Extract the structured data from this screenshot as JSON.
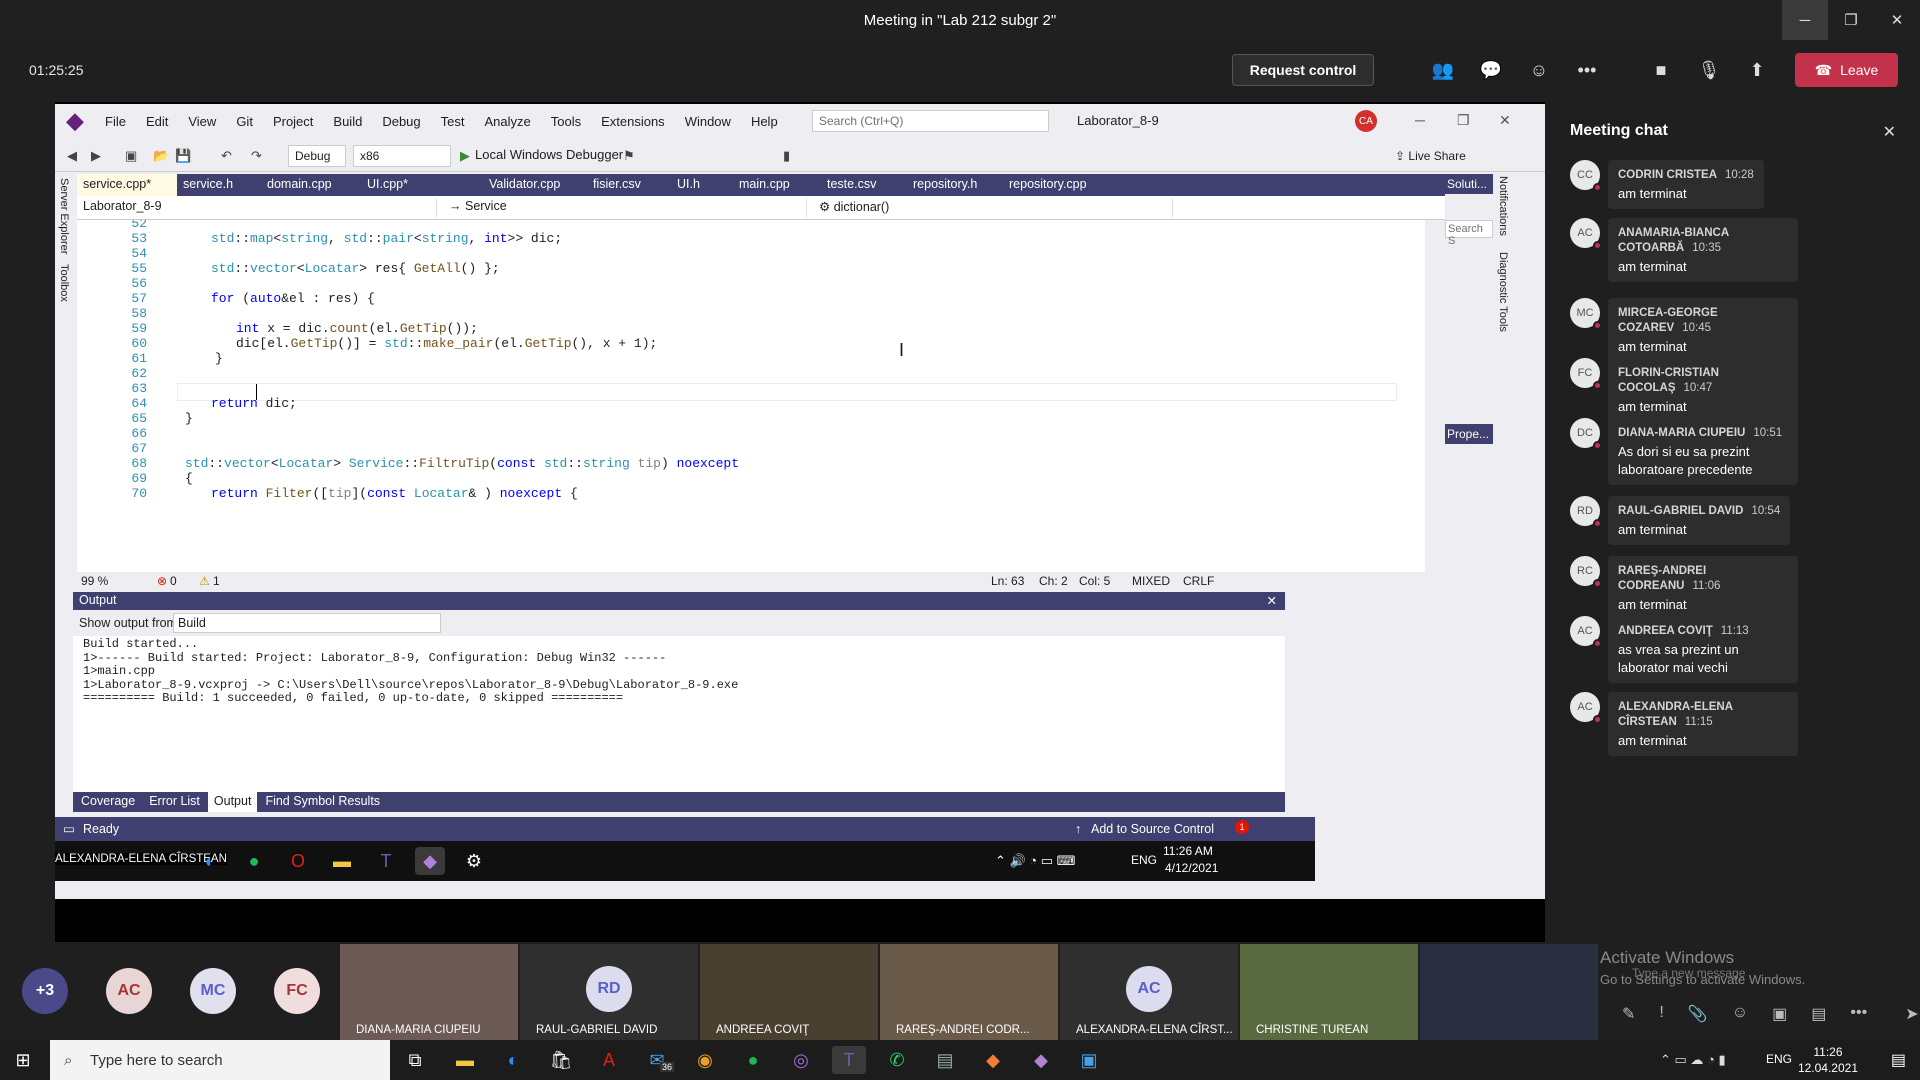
{
  "teams": {
    "title": "Meeting in \"Lab 212 subgr 2\"",
    "timer": "01:25:25",
    "request_control": "Request control",
    "leave": "Leave"
  },
  "vs": {
    "menu": [
      "File",
      "Edit",
      "View",
      "Git",
      "Project",
      "Build",
      "Debug",
      "Test",
      "Analyze",
      "Tools",
      "Extensions",
      "Window",
      "Help"
    ],
    "search_placeholder": "Search (Ctrl+Q)",
    "solution_name": "Laborator_8-9",
    "avatar": "CA",
    "config": "Debug",
    "platform": "x86",
    "run": "Local Windows Debugger",
    "live_share": "Live Share",
    "left_tabs": [
      "Server Explorer",
      "Toolbox"
    ],
    "tabs": [
      "service.cpp*",
      "service.h",
      "domain.cpp",
      "UI.cpp*",
      "Validator.cpp",
      "fisier.csv",
      "UI.h",
      "main.cpp",
      "teste.csv",
      "repository.h",
      "repository.cpp"
    ],
    "nav_project": "Laborator_8-9",
    "nav_class": "Service",
    "nav_member": "dictionar()",
    "line_numbers": [
      "52",
      "53",
      "54",
      "55",
      "56",
      "57",
      "58",
      "59",
      "60",
      "61",
      "62",
      "63",
      "64",
      "65",
      "66",
      "67",
      "68",
      "69",
      "70"
    ],
    "zoom": "99 %",
    "errors": "0",
    "warnings": "1",
    "ln": "Ln: 63",
    "ch": "Ch: 2",
    "col": "Col: 5",
    "mixed": "MIXED",
    "crlf": "CRLF",
    "sol_tab": "Soluti...",
    "sol_search": "Search S",
    "props_tab": "Prope...",
    "right_tabs": [
      "Notifications",
      "Diagnostic Tools"
    ],
    "output": {
      "title": "Output",
      "show_from_label": "Show output from:",
      "show_from_value": "Build",
      "lines": [
        "Build started...",
        "1>------ Build started: Project: Laborator_8-9, Configuration: Debug Win32 ------",
        "1>main.cpp",
        "1>Laborator_8-9.vcxproj -> C:\\Users\\Dell\\source\\repos\\Laborator_8-9\\Debug\\Laborator_8-9.exe",
        "========== Build: 1 succeeded, 0 failed, 0 up-to-date, 0 skipped =========="
      ]
    },
    "bottom_tabs": [
      "Coverage",
      "Error List",
      "Output",
      "Find Symbol Results"
    ],
    "status": "Ready",
    "source_control": "Add to Source Control",
    "notifications_count": "1"
  },
  "inner_taskbar": {
    "presenter": "ALEXANDRA-ELENA CÎRSTEAN",
    "lang": "ENG",
    "time": "11:26 AM",
    "date": "4/12/2021"
  },
  "chat": {
    "title": "Meeting chat",
    "messages": [
      {
        "initials": "CC",
        "name": "CODRIN CRISTEA",
        "time": "10:28",
        "text": "am terminat"
      },
      {
        "initials": "AC",
        "name": "ANAMARIA-BIANCA COTOARBĂ",
        "time": "10:35",
        "text": "am terminat"
      },
      {
        "initials": "MC",
        "name": "MIRCEA-GEORGE COZAREV",
        "time": "10:45",
        "text": "am terminat"
      },
      {
        "initials": "FC",
        "name": "FLORIN-CRISTIAN COCOLAŞ",
        "time": "10:47",
        "text": "am terminat"
      },
      {
        "initials": "DC",
        "name": "DIANA-MARIA CIUPEIU",
        "time": "10:51",
        "text": "As dori si eu sa prezint laboratoare precedente"
      },
      {
        "initials": "RD",
        "name": "RAUL-GABRIEL DAVID",
        "time": "10:54",
        "text": "am terminat"
      },
      {
        "initials": "RC",
        "name": "RAREŞ-ANDREI CODREANU",
        "time": "11:06",
        "text": "am terminat"
      },
      {
        "initials": "AC",
        "name": "ANDREEA COVIŢ",
        "time": "11:13",
        "text": "as vrea sa prezint un laborator mai vechi"
      },
      {
        "initials": "AC",
        "name": "ALEXANDRA-ELENA CÎRSTEAN",
        "time": "11:15",
        "text": "am terminat"
      }
    ],
    "input_placeholder": "Type a new message",
    "activate_title": "Activate Windows",
    "activate_sub": "Go to Settings to activate Windows."
  },
  "participants": {
    "more": "+3",
    "circles": [
      "AC",
      "MC",
      "FC"
    ],
    "tiles": [
      {
        "name": "DIANA-MARIA CIUPEIU",
        "initials": ""
      },
      {
        "name": "RAUL-GABRIEL DAVID",
        "initials": "RD"
      },
      {
        "name": "ANDREEA COVIŢ",
        "initials": ""
      },
      {
        "name": "RAREŞ-ANDREI CODR...",
        "initials": ""
      },
      {
        "name": "ALEXANDRA-ELENA CÎRST...",
        "initials": "AC"
      },
      {
        "name": "CHRISTINE TUREAN",
        "initials": ""
      },
      {
        "name": "",
        "initials": ""
      }
    ]
  },
  "windows": {
    "search_placeholder": "Type here to search",
    "mail_badge": "36",
    "lang": "ENG",
    "time": "11:26",
    "date": "12.04.2021"
  }
}
